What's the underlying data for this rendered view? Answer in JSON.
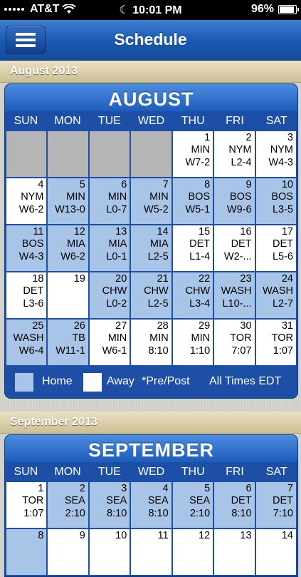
{
  "status_bar": {
    "carrier": "AT&T",
    "time": "10:01 PM",
    "battery": "96%"
  },
  "header": {
    "title": "Schedule"
  },
  "months": [
    {
      "section_label": "August 2013",
      "calendar_title": "AUGUST",
      "weekdays": [
        "SUN",
        "MON",
        "TUE",
        "WED",
        "THU",
        "FRI",
        "SAT"
      ],
      "cells": [
        {
          "type": "empty",
          "day": "",
          "opp": "",
          "res": ""
        },
        {
          "type": "empty",
          "day": "",
          "opp": "",
          "res": ""
        },
        {
          "type": "empty",
          "day": "",
          "opp": "",
          "res": ""
        },
        {
          "type": "empty",
          "day": "",
          "opp": "",
          "res": ""
        },
        {
          "type": "away",
          "day": "1",
          "opp": "MIN",
          "res": "W7-2"
        },
        {
          "type": "away",
          "day": "2",
          "opp": "NYM",
          "res": "L2-4"
        },
        {
          "type": "away",
          "day": "3",
          "opp": "NYM",
          "res": "W4-3"
        },
        {
          "type": "away",
          "day": "4",
          "opp": "NYM",
          "res": "W6-2"
        },
        {
          "type": "home",
          "day": "5",
          "opp": "MIN",
          "res": "W13-0"
        },
        {
          "type": "home",
          "day": "6",
          "opp": "MIN",
          "res": "L0-7"
        },
        {
          "type": "home",
          "day": "7",
          "opp": "MIN",
          "res": "W5-2"
        },
        {
          "type": "home",
          "day": "8",
          "opp": "BOS",
          "res": "W5-1"
        },
        {
          "type": "home",
          "day": "9",
          "opp": "BOS",
          "res": "W9-6"
        },
        {
          "type": "home",
          "day": "10",
          "opp": "BOS",
          "res": "L3-5"
        },
        {
          "type": "home",
          "day": "11",
          "opp": "BOS",
          "res": "W4-3"
        },
        {
          "type": "home",
          "day": "12",
          "opp": "MIA",
          "res": "W6-2"
        },
        {
          "type": "home",
          "day": "13",
          "opp": "MIA",
          "res": "L0-1"
        },
        {
          "type": "home",
          "day": "14",
          "opp": "MIA",
          "res": "L2-5"
        },
        {
          "type": "away",
          "day": "15",
          "opp": "DET",
          "res": "L1-4"
        },
        {
          "type": "away",
          "day": "16",
          "opp": "DET",
          "res": "W2-..."
        },
        {
          "type": "away",
          "day": "17",
          "opp": "DET",
          "res": "L5-6"
        },
        {
          "type": "away",
          "day": "18",
          "opp": "DET",
          "res": "L3-6"
        },
        {
          "type": "away",
          "day": "19",
          "opp": "",
          "res": ""
        },
        {
          "type": "home",
          "day": "20",
          "opp": "CHW",
          "res": "L0-2"
        },
        {
          "type": "home",
          "day": "21",
          "opp": "CHW",
          "res": "L2-5"
        },
        {
          "type": "home",
          "day": "22",
          "opp": "CHW",
          "res": "L3-4"
        },
        {
          "type": "home",
          "day": "23",
          "opp": "WASH",
          "res": "L10-..."
        },
        {
          "type": "home",
          "day": "24",
          "opp": "WASH",
          "res": "L2-7"
        },
        {
          "type": "home",
          "day": "25",
          "opp": "WASH",
          "res": "W6-4"
        },
        {
          "type": "home",
          "day": "26",
          "opp": "TB",
          "res": "W11-1"
        },
        {
          "type": "away",
          "day": "27",
          "opp": "MIN",
          "res": "W6-1"
        },
        {
          "type": "away",
          "day": "28",
          "opp": "MIN",
          "res": "8:10"
        },
        {
          "type": "away",
          "day": "29",
          "opp": "MIN",
          "res": "1:10"
        },
        {
          "type": "away",
          "day": "30",
          "opp": "TOR",
          "res": "7:07"
        },
        {
          "type": "away",
          "day": "31",
          "opp": "TOR",
          "res": "1:07"
        }
      ],
      "legend": {
        "home": "Home",
        "away": "Away",
        "pre_post": "*Pre/Post",
        "times": "All Times EDT"
      }
    },
    {
      "section_label": "September 2013",
      "calendar_title": "SEPTEMBER",
      "weekdays": [
        "SUN",
        "MON",
        "TUE",
        "WED",
        "THU",
        "FRI",
        "SAT"
      ],
      "cells": [
        {
          "type": "away",
          "day": "1",
          "opp": "TOR",
          "res": "1:07"
        },
        {
          "type": "home",
          "day": "2",
          "opp": "SEA",
          "res": "2:10"
        },
        {
          "type": "home",
          "day": "3",
          "opp": "SEA",
          "res": "8:10"
        },
        {
          "type": "home",
          "day": "4",
          "opp": "SEA",
          "res": "8:10"
        },
        {
          "type": "home",
          "day": "5",
          "opp": "SEA",
          "res": "2:10"
        },
        {
          "type": "home",
          "day": "6",
          "opp": "DET",
          "res": "8:10"
        },
        {
          "type": "home",
          "day": "7",
          "opp": "DET",
          "res": "7:10"
        },
        {
          "type": "home",
          "day": "8",
          "opp": "",
          "res": ""
        },
        {
          "type": "away",
          "day": "9",
          "opp": "",
          "res": ""
        },
        {
          "type": "away",
          "day": "10",
          "opp": "",
          "res": ""
        },
        {
          "type": "away",
          "day": "11",
          "opp": "",
          "res": ""
        },
        {
          "type": "away",
          "day": "12",
          "opp": "",
          "res": ""
        },
        {
          "type": "away",
          "day": "13",
          "opp": "",
          "res": ""
        },
        {
          "type": "away",
          "day": "14",
          "opp": "",
          "res": ""
        }
      ]
    }
  ]
}
